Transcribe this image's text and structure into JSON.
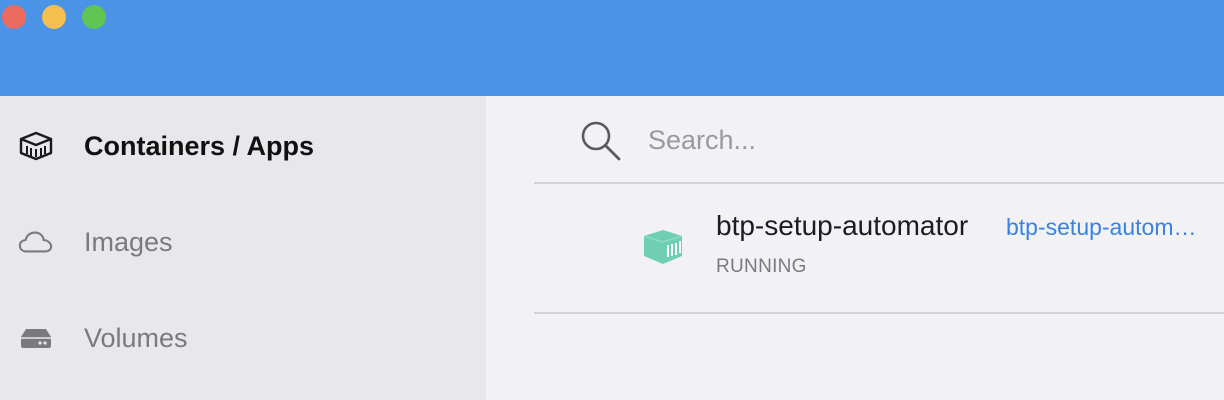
{
  "window": {
    "controls": [
      "close",
      "minimize",
      "zoom"
    ],
    "colors": {
      "titlebar": "#4b93e7",
      "close": "#ec6a5e",
      "minimize": "#f4bf4f",
      "zoom": "#61c554"
    }
  },
  "sidebar": {
    "items": [
      {
        "label": "Containers / Apps",
        "icon": "container-icon",
        "active": true
      },
      {
        "label": "Images",
        "icon": "cloud-icon",
        "active": false
      },
      {
        "label": "Volumes",
        "icon": "drive-icon",
        "active": false
      }
    ]
  },
  "search": {
    "placeholder": "Search...",
    "value": ""
  },
  "containers": [
    {
      "name": "btp-setup-automator",
      "image": "btp-setup-automator",
      "status": "RUNNING",
      "icon": "running-container-icon",
      "status_color": "#6fcfb2"
    }
  ],
  "colors": {
    "accent": "#3b82e0",
    "running": "#6fcfb2"
  }
}
